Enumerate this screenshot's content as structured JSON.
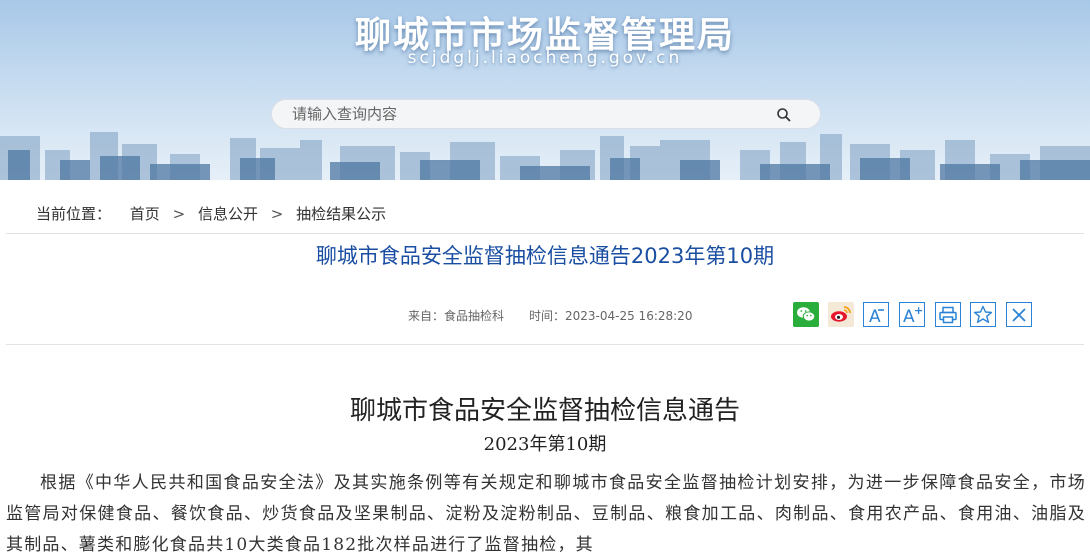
{
  "header": {
    "site_title": "聊城市市场监督管理局",
    "site_domain": "scjdglj.liaocheng.gov.cn",
    "search_placeholder": "请输入查询内容"
  },
  "breadcrumb": {
    "label": "当前位置：",
    "items": [
      "首页",
      "信息公开",
      "抽检结果公示"
    ],
    "separator": ">"
  },
  "article": {
    "title": "聊城市食品安全监督抽检信息通告2023年第10期",
    "source": "来自：食品抽检科",
    "time": "时间：2023-04-25 16:28:20"
  },
  "share_tools": {
    "icons": [
      "wechat-icon",
      "weibo-icon",
      "font-decrease-icon",
      "font-increase-icon",
      "print-icon",
      "favorite-icon",
      "close-icon"
    ],
    "font_small_label": "A",
    "font_large_label": "A",
    "font_large_sup": "+",
    "accent": "#2a83d6",
    "wechat_color": "#2aae3b",
    "weibo_color": "#e6162d"
  },
  "document": {
    "heading": "聊城市食品安全监督抽检信息通告",
    "issue": "2023年第10期",
    "body": "根据《中华人民共和国食品安全法》及其实施条例等有关规定和聊城市食品安全监督抽检计划安排，为进一步保障食品安全，市场监管局对保健食品、餐饮食品、炒货食品及坚果制品、淀粉及淀粉制品、豆制品、粮食加工品、肉制品、食用农产品、食用油、油脂及其制品、薯类和膨化食品共10大类食品182批次样品进行了监督抽检，其"
  }
}
